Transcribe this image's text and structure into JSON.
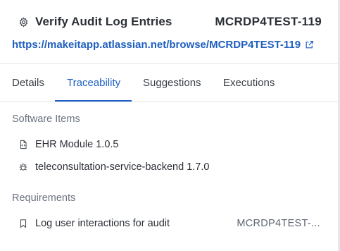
{
  "header": {
    "title": "Verify Audit Log Entries",
    "issue_key": "MCRDP4TEST-119",
    "url": "https://makeitapp.atlassian.net/browse/MCRDP4TEST-119"
  },
  "tabs": [
    {
      "label": "Details",
      "active": false
    },
    {
      "label": "Traceability",
      "active": true
    },
    {
      "label": "Suggestions",
      "active": false
    },
    {
      "label": "Executions",
      "active": false
    }
  ],
  "software_items": {
    "heading": "Software Items",
    "items": [
      {
        "label": "EHR Module 1.0.5",
        "icon": "code-file-icon"
      },
      {
        "label": "teleconsultation-service-backend 1.7.0",
        "icon": "bug-icon"
      }
    ]
  },
  "requirements": {
    "heading": "Requirements",
    "items": [
      {
        "label": "Log user interactions for audit",
        "key": "MCRDP4TEST-...",
        "icon": "bookmark-icon"
      }
    ]
  },
  "colors": {
    "accent": "#1d5fc4",
    "link": "#1f5fbf",
    "muted_text": "#6b7380"
  }
}
